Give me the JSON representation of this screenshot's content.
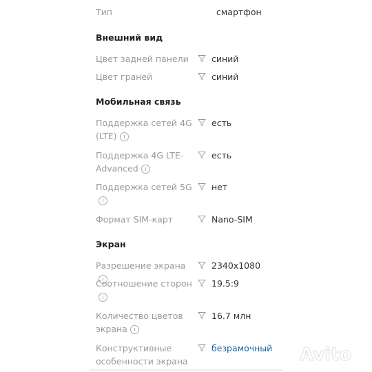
{
  "sections": [
    {
      "title": "",
      "rows": [
        {
          "label": "Тип",
          "value": "смартфон",
          "filter": false
        }
      ]
    },
    {
      "title": "Внешний вид",
      "rows": [
        {
          "label": "Цвет задней панели",
          "value": "синий",
          "filter": true
        },
        {
          "label": "Цвет граней",
          "value": "синий",
          "filter": true
        }
      ]
    },
    {
      "title": "Мобильная связь",
      "rows": [
        {
          "label": "Поддержка сетей 4G (LTE)",
          "value": "есть",
          "filter": true,
          "info": true
        },
        {
          "label": "Поддержка 4G LTE-Advanced",
          "value": "есть",
          "filter": true,
          "info": true
        },
        {
          "label": "Поддержка сетей 5G",
          "value": "нет",
          "filter": true,
          "info": true
        },
        {
          "label": "Формат SIM-карт",
          "value": "Nano-SIM",
          "filter": true
        }
      ]
    },
    {
      "title": "Экран",
      "rows": [
        {
          "label": "Разрешение экрана",
          "value": "2340x1080",
          "filter": true,
          "info": true
        },
        {
          "label": "Соотношение сторон",
          "value": "19.5:9",
          "filter": true,
          "info": true
        },
        {
          "label": "Количество цветов экрана",
          "value": "16.7 млн",
          "filter": true,
          "info": true
        },
        {
          "label": "Конструктивные особенности экрана",
          "value": "безрамочный",
          "filter": true,
          "link": true
        }
      ]
    }
  ],
  "watermark": "Avito",
  "colors": {
    "label": "#9a9a9a",
    "value": "#333333",
    "link": "#1565a8"
  }
}
